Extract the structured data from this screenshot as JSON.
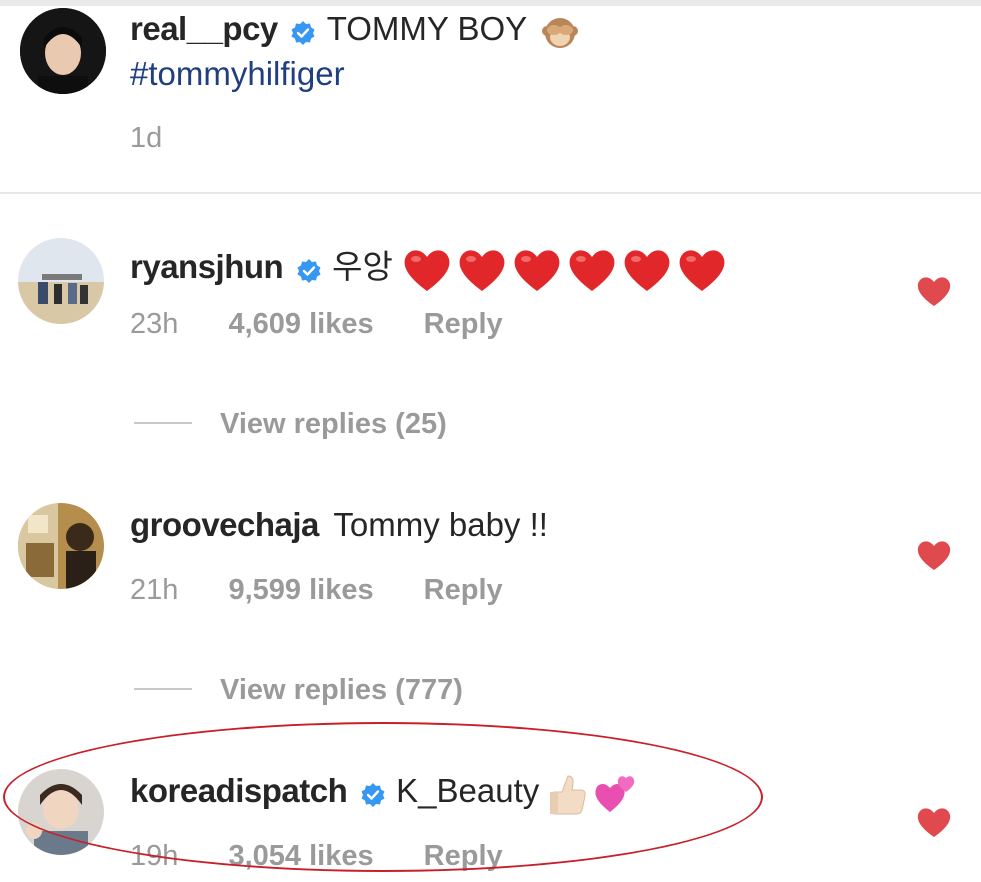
{
  "caption": {
    "username": "real__pcy",
    "text": "TOMMY BOY",
    "hashtag": "#tommyhilfiger",
    "time": "1d",
    "emoji": "see-no-evil-monkey-icon"
  },
  "comments": [
    {
      "username": "ryansjhun",
      "verified": true,
      "text": "우앙",
      "emoji": "red-heart-icon x6",
      "time": "23h",
      "likes": "4,609 likes",
      "reply_label": "Reply",
      "view_replies": "View replies (25)"
    },
    {
      "username": "groovechaja",
      "verified": false,
      "text": "Tommy baby !!",
      "time": "21h",
      "likes": "9,599 likes",
      "reply_label": "Reply",
      "view_replies": "View replies (777)"
    },
    {
      "username": "koreadispatch",
      "verified": true,
      "text": "K_Beauty",
      "emoji": "thumbs-up-icon, two-hearts-icon",
      "time": "19h",
      "likes": "3,054 likes",
      "reply_label": "Reply"
    }
  ],
  "colors": {
    "heart": "#e0494d",
    "verified": "#3897f0",
    "hashtag": "#1f3f80",
    "annotation_oval": "#c8202a",
    "meta_gray": "#9a9a9a"
  }
}
